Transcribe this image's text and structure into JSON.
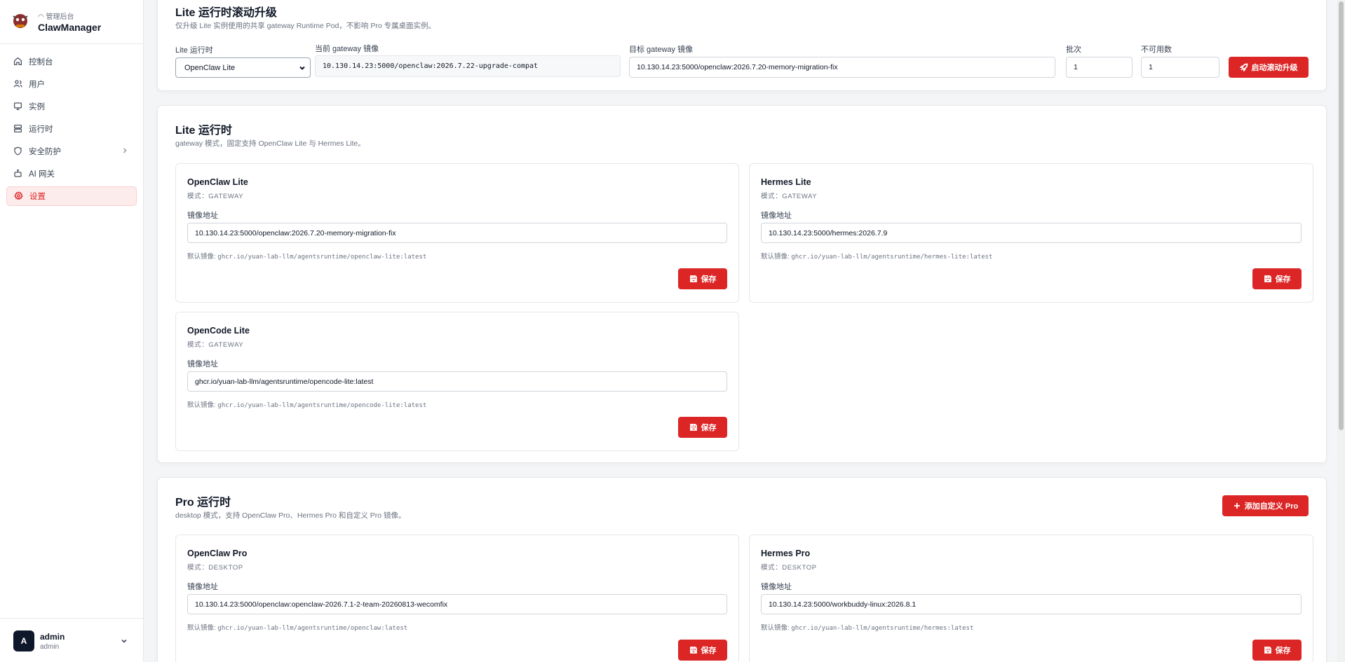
{
  "brand": {
    "subtitle": "管理后台",
    "title": "ClawManager"
  },
  "nav": [
    {
      "label": "控制台",
      "icon": "home-icon"
    },
    {
      "label": "用户",
      "icon": "users-icon"
    },
    {
      "label": "实例",
      "icon": "monitor-icon"
    },
    {
      "label": "运行时",
      "icon": "server-icon"
    },
    {
      "label": "安全防护",
      "icon": "shield-icon"
    },
    {
      "label": "AI 网关",
      "icon": "bot-icon"
    },
    {
      "label": "设置",
      "icon": "gear-icon"
    }
  ],
  "user": {
    "avatar": "A",
    "name": "admin",
    "role": "admin"
  },
  "rolling": {
    "title": "Lite 运行时滚动升级",
    "desc": "仅升级 Lite 实例使用的共享 gateway Runtime Pod，不影响 Pro 专属桌面实例。",
    "runtime_label": "Lite 运行时",
    "runtime_value": "OpenClaw Lite",
    "current_label": "当前 gateway 镜像",
    "current_value": "10.130.14.23:5000/openclaw:2026.7.22-upgrade-compat",
    "target_label": "目标 gateway 镜像",
    "target_value": "10.130.14.23:5000/openclaw:2026.7.20-memory-migration-fix",
    "batch_label": "批次",
    "batch_value": "1",
    "unavail_label": "不可用数",
    "unavail_value": "1",
    "start_button": "启动滚动升级"
  },
  "lite": {
    "title": "Lite 运行时",
    "desc": "gateway 模式，固定支持 OpenClaw Lite 与 Hermes Lite。",
    "cards": [
      {
        "name": "OpenClaw Lite",
        "mode": "模式：GATEWAY",
        "image_label": "镜像地址",
        "image": "10.130.14.23:5000/openclaw:2026.7.20-memory-migration-fix",
        "default_prefix": "默认镜像:",
        "default_image": "ghcr.io/yuan-lab-llm/agentsruntime/openclaw-lite:latest",
        "save": "保存"
      },
      {
        "name": "Hermes Lite",
        "mode": "模式：GATEWAY",
        "image_label": "镜像地址",
        "image": "10.130.14.23:5000/hermes:2026.7.9",
        "default_prefix": "默认镜像:",
        "default_image": "ghcr.io/yuan-lab-llm/agentsruntime/hermes-lite:latest",
        "save": "保存"
      },
      {
        "name": "OpenCode Lite",
        "mode": "模式：GATEWAY",
        "image_label": "镜像地址",
        "image": "ghcr.io/yuan-lab-llm/agentsruntime/opencode-lite:latest",
        "default_prefix": "默认镜像:",
        "default_image": "ghcr.io/yuan-lab-llm/agentsruntime/opencode-lite:latest",
        "save": "保存"
      }
    ]
  },
  "pro": {
    "title": "Pro 运行时",
    "desc": "desktop 模式，支持 OpenClaw Pro、Hermes Pro 和自定义 Pro 镜像。",
    "add_button": "添加自定义 Pro",
    "cards": [
      {
        "name": "OpenClaw Pro",
        "mode": "模式：DESKTOP",
        "image_label": "镜像地址",
        "image": "10.130.14.23:5000/openclaw:openclaw-2026.7.1-2-team-20260813-wecomfix",
        "default_prefix": "默认镜像:",
        "default_image": "ghcr.io/yuan-lab-llm/agentsruntime/openclaw:latest",
        "save": "保存"
      },
      {
        "name": "Hermes Pro",
        "mode": "模式：DESKTOP",
        "image_label": "镜像地址",
        "image": "10.130.14.23:5000/workbuddy-linux:2026.8.1",
        "default_prefix": "默认镜像:",
        "default_image": "ghcr.io/yuan-lab-llm/agentsruntime/hermes:latest",
        "save": "保存"
      }
    ]
  },
  "colors": {
    "accent": "#dc2626",
    "active_bg": "#fdecec"
  }
}
